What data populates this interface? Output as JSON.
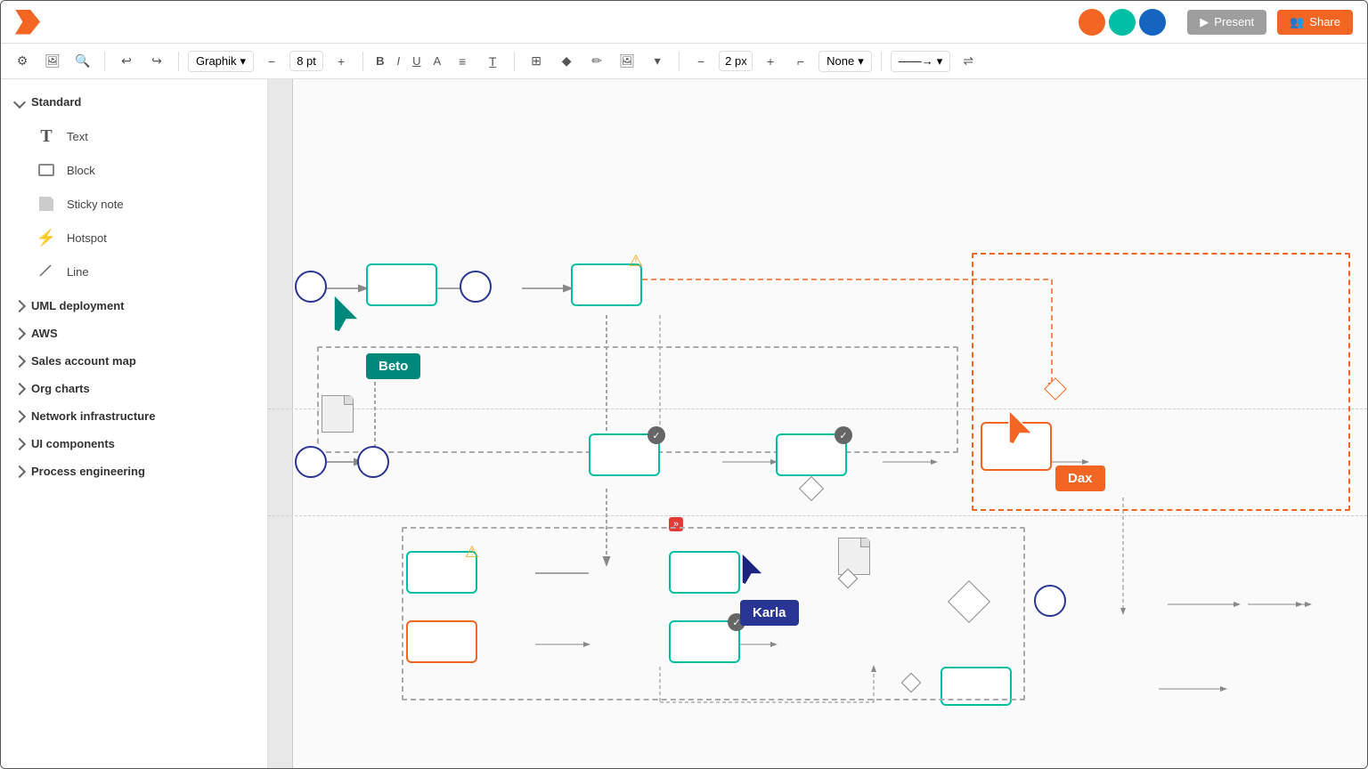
{
  "app": {
    "logo_alt": "Lucidchart logo"
  },
  "topbar": {
    "present_label": "Present",
    "share_label": "Share",
    "avatars": [
      "#F26522",
      "#00BFA5",
      "#1565C0"
    ]
  },
  "toolbar": {
    "undo_label": "↩",
    "redo_label": "↪",
    "font_family": "Graphik",
    "font_size": "8 pt",
    "bold_label": "B",
    "italic_label": "I",
    "underline_label": "U",
    "font_color_label": "A",
    "align_label": "≡",
    "text_format_label": "T̲",
    "table_label": "⊞",
    "fill_label": "🪣",
    "line_label": "✏",
    "image_label": "🖼",
    "line_width": "2 px",
    "line_style": "None",
    "arrow_style": "→"
  },
  "sidebar": {
    "standard": {
      "label": "Standard",
      "expanded": true,
      "items": [
        {
          "id": "text",
          "label": "Text",
          "icon": "T"
        },
        {
          "id": "block",
          "label": "Block",
          "icon": "□"
        },
        {
          "id": "sticky-note",
          "label": "Sticky note",
          "icon": "sticky"
        },
        {
          "id": "hotspot",
          "label": "Hotspot",
          "icon": "⚡"
        },
        {
          "id": "line",
          "label": "Line",
          "icon": "line"
        }
      ]
    },
    "sections": [
      {
        "id": "uml-deployment",
        "label": "UML deployment",
        "expanded": false
      },
      {
        "id": "aws",
        "label": "AWS",
        "expanded": false
      },
      {
        "id": "sales-account-map",
        "label": "Sales account map",
        "expanded": false
      },
      {
        "id": "org-charts",
        "label": "Org charts",
        "expanded": false
      },
      {
        "id": "network-infrastructure",
        "label": "Network infrastructure",
        "expanded": false
      },
      {
        "id": "ui-components",
        "label": "UI components",
        "expanded": false
      },
      {
        "id": "process-engineering",
        "label": "Process engineering",
        "expanded": false
      }
    ]
  },
  "diagram": {
    "label_beto": "Beto",
    "label_dax": "Dax",
    "label_karla": "Karla"
  }
}
